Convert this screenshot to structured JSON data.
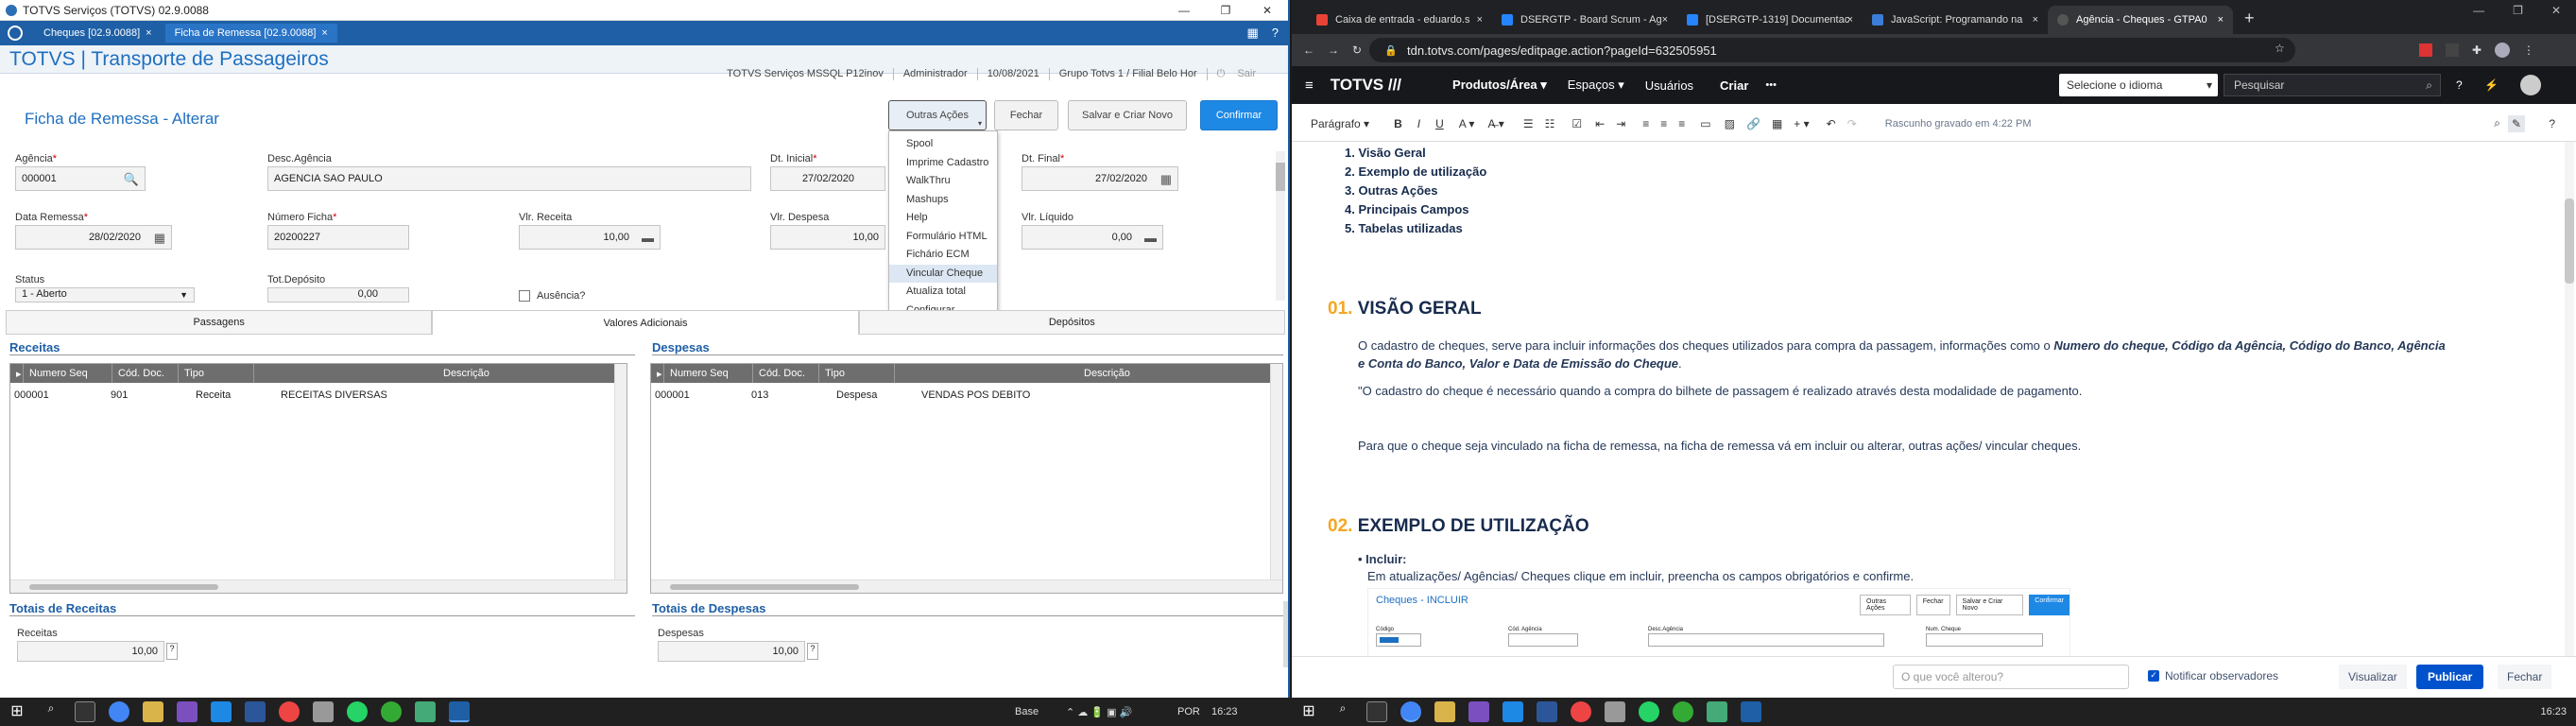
{
  "left": {
    "window_title": "TOTVS Serviços (TOTVS) 02.9.0088",
    "tabs": [
      "Cheques [02.9.0088]",
      "Ficha de Remessa [02.9.0088]"
    ],
    "brand": "TOTVS | Transporte de Passageiros",
    "header_info": [
      "TOTVS Serviços MSSQL P12inov",
      "Administrador",
      "10/08/2021",
      "Grupo Totvs 1 / Filial Belo Hor",
      "Sair"
    ],
    "form_title": "Ficha de Remessa - Alterar",
    "buttons": {
      "outras_acoes": "Outras Ações",
      "fechar": "Fechar",
      "salvar_novo": "Salvar e Criar Novo",
      "confirmar": "Confirmar"
    },
    "menu": [
      "Spool",
      "Imprime Cadastro",
      "WalkThru",
      "Mashups",
      "Help",
      "Formulário HTML",
      "Fichário ECM",
      "Vincular Cheque",
      "Atualiza total",
      "Configurar"
    ],
    "menu_highlight": "Vincular Cheque",
    "fields": {
      "agencia_label": "Agência",
      "agencia": "000001",
      "desc_agencia_label": "Desc.Agência",
      "desc_agencia": "AGENCIA SAO PAULO",
      "dt_inicial_label": "Dt. Inicial",
      "dt_inicial": "27/02/2020",
      "dt_final_label": "Dt. Final",
      "dt_final": "27/02/2020",
      "data_remessa_label": "Data Remessa",
      "data_remessa": "28/02/2020",
      "numero_ficha_label": "Número Ficha",
      "numero_ficha": "20200227",
      "vlr_receita_label": "Vlr. Receita",
      "vlr_receita": "10,00",
      "vlr_despesa_label": "Vlr. Despesa",
      "vlr_despesa": "10,00",
      "vlr_liquido_label": "Vlr. Líquido",
      "vlr_liquido": "0,00",
      "status_label": "Status",
      "status": "1 - Aberto",
      "tot_deposito_label": "Tot.Depósito",
      "tot_deposito": "0,00",
      "ausencia_label": "Ausência?"
    },
    "subtabs": [
      "Passagens",
      "Valores Adicionais",
      "Depósitos"
    ],
    "receitas": {
      "title": "Receitas",
      "columns": [
        "Numero Seq",
        "Cód. Doc.",
        "Tipo",
        "Descrição"
      ],
      "rows": [
        [
          "000001",
          "901",
          "Receita",
          "RECEITAS DIVERSAS"
        ]
      ]
    },
    "despesas": {
      "title": "Despesas",
      "columns": [
        "Numero Seq",
        "Cód. Doc.",
        "Tipo",
        "Descrição"
      ],
      "rows": [
        [
          "000001",
          "013",
          "Despesa",
          "VENDAS POS DEBITO"
        ]
      ]
    },
    "totais_receitas": {
      "title": "Totais de Receitas",
      "label": "Receitas",
      "value": "10,00"
    },
    "totais_despesas": {
      "title": "Totais de Despesas",
      "label": "Despesas",
      "value": "10,00"
    }
  },
  "right": {
    "tabs": [
      "Caixa de entrada - eduardo.s",
      "DSERGTP - Board Scrum - Ag",
      "[DSERGTP-1319] Documentac",
      "JavaScript: Programando na",
      "Agência - Cheques - GTPA0"
    ],
    "url": "tdn.totvs.com/pages/editpage.action?pageId=632505951",
    "nav": {
      "logo": "TOTVS ///",
      "items": [
        "Produtos/Área ▾",
        "Espaços ▾",
        "Usuários",
        "Criar",
        "•••"
      ],
      "lang": "Selecione o idioma",
      "search": "Pesquisar"
    },
    "editor": {
      "style": "Parágrafo",
      "draft": "Rascunho gravado em 4:22 PM"
    },
    "toc": [
      "Visão Geral",
      "Exemplo de utilização",
      "Outras Ações",
      "Principais Campos",
      "Tabelas utilizadas"
    ],
    "h1_num": "01.",
    "h1": "VISÃO GERAL",
    "p1a": "O cadastro de cheques, serve para incluir informações dos cheques utilizados para compra da passagem, informações como o",
    "p1b": "Numero do cheque, Código da Agência, Código do Banco, Agência",
    "p1c": "e Conta do Banco, Valor e Data de Emissão do Cheque",
    "p2": "\"O cadastro do cheque é necessário quando a compra do bilhete de passagem é realizado através desta modalidade de pagamento.",
    "p3": "Para que o cheque seja vinculado na ficha de remessa, na ficha de remessa vá em incluir ou alterar, outras ações/ vincular cheques.",
    "h2_num": "02.",
    "h2": "EXEMPLO DE UTILIZAÇÃO",
    "bullet": "Incluir:",
    "bullet_text": "Em atualizações/ Agências/ Cheques clique em incluir, preencha os campos obrigatórios e confirme.",
    "mini": {
      "title": "Cheques - INCLUIR",
      "buttons": [
        "Outras Ações",
        "Fechar",
        "Salvar e Criar Novo",
        "Confirmar"
      ],
      "fields": [
        "Código",
        "Cód. Agência",
        "Desc.Agência",
        "Num. Cheque"
      ]
    },
    "bottom": {
      "placeholder": "O que você alterou?",
      "notify": "Notificar observadores",
      "visualizar": "Visualizar",
      "publicar": "Publicar",
      "fechar": "Fechar"
    }
  },
  "taskbar_left": {
    "lang": "Base",
    "kb": "POR",
    "time": "16:23"
  },
  "taskbar_right": {
    "time": "16:23"
  }
}
